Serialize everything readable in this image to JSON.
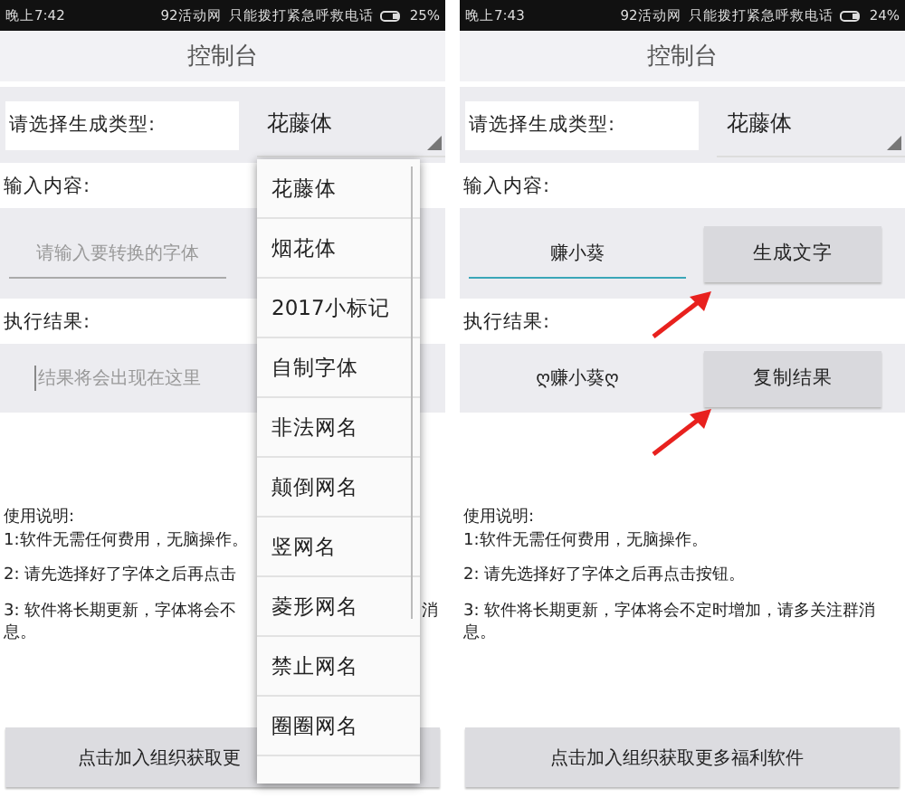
{
  "screens": [
    {
      "status_bar": {
        "time": "晚上7:42",
        "carrier": "92活动网",
        "notice": "只能拨打紧急呼救电话",
        "battery": "25%"
      },
      "title": "控制台",
      "type_label": "请选择生成类型:",
      "type_value": "花藤体",
      "input_label": "输入内容:",
      "input": {
        "placeholder": "请输入要转换的字体",
        "focused": false
      },
      "result_label": "执行结果:",
      "result": {
        "placeholder": "结果将会出现在这里"
      },
      "instructions": [
        {
          "text": "使用说明:"
        },
        {
          "text": "1:软件无需任何费用，无脑操作。"
        },
        {
          "text": "2: 请先选择好了字体之后再点击"
        },
        {
          "text": "3: 软件将长期更新，字体将会不",
          "tail": "消"
        },
        {
          "text": "息。"
        }
      ],
      "join_button": "点击加入组织获取更",
      "dropdown": {
        "items": [
          "花藤体",
          "烟花体",
          "2017小标记",
          "自制字体",
          "非法网名",
          "颠倒网名",
          "竖网名",
          "菱形网名",
          "禁止网名",
          "圈圈网名"
        ]
      }
    },
    {
      "status_bar": {
        "time": "晚上7:43",
        "carrier": "92活动网",
        "notice": "只能拨打紧急呼救电话",
        "battery": "24%"
      },
      "title": "控制台",
      "type_label": "请选择生成类型:",
      "type_value": "花藤体",
      "input_label": "输入内容:",
      "input": {
        "value": "赚小葵",
        "focused": true
      },
      "generate_button": "生成文字",
      "result_label": "执行结果:",
      "result": {
        "value": "ღ赚小葵ღ"
      },
      "copy_button": "复制结果",
      "instructions": [
        {
          "text": "使用说明:"
        },
        {
          "text": "1:软件无需任何费用，无脑操作。"
        },
        {
          "text": "2: 请先选择好了字体之后再点击按钮。"
        },
        {
          "text": "3: 软件将长期更新，字体将会不定时增加，请多关注群消息。"
        }
      ],
      "join_button": "点击加入组织获取更多福利软件",
      "annotations": [
        {
          "kind": "arrow"
        },
        {
          "kind": "arrow"
        }
      ]
    }
  ]
}
